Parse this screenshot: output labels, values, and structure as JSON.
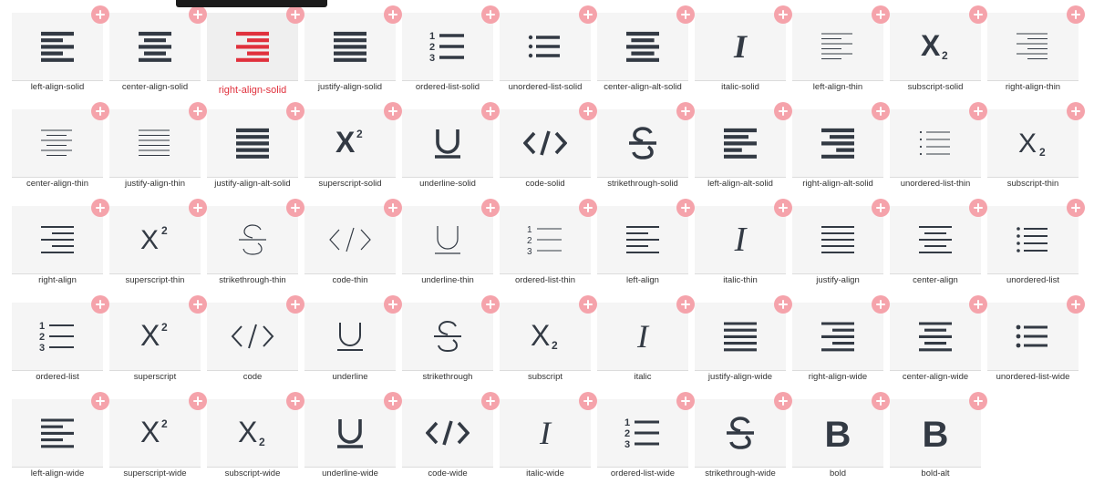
{
  "colors": {
    "icon": "#333a44",
    "active_icon": "#e0313d",
    "plus": "#f5a3ab",
    "tile": "#f5f5f5"
  },
  "active_index": 2,
  "tooltip": {
    "text": ""
  },
  "icons": [
    {
      "label": "left-align-solid"
    },
    {
      "label": "center-align-solid"
    },
    {
      "label": "right-align-solid"
    },
    {
      "label": "justify-align-solid"
    },
    {
      "label": "ordered-list-solid"
    },
    {
      "label": "unordered-list-solid"
    },
    {
      "label": "center-align-alt-solid"
    },
    {
      "label": "italic-solid"
    },
    {
      "label": "left-align-thin"
    },
    {
      "label": "subscript-solid"
    },
    {
      "label": "right-align-thin"
    },
    {
      "label": "center-align-thin"
    },
    {
      "label": "justify-align-thin"
    },
    {
      "label": "justify-align-alt-solid"
    },
    {
      "label": "superscript-solid"
    },
    {
      "label": "underline-solid"
    },
    {
      "label": "code-solid"
    },
    {
      "label": "strikethrough-solid"
    },
    {
      "label": "left-align-alt-solid"
    },
    {
      "label": "right-align-alt-solid"
    },
    {
      "label": "unordered-list-thin"
    },
    {
      "label": "subscript-thin"
    },
    {
      "label": "right-align"
    },
    {
      "label": "superscript-thin"
    },
    {
      "label": "strikethrough-thin"
    },
    {
      "label": "code-thin"
    },
    {
      "label": "underline-thin"
    },
    {
      "label": "ordered-list-thin"
    },
    {
      "label": "left-align"
    },
    {
      "label": "italic-thin"
    },
    {
      "label": "justify-align"
    },
    {
      "label": "center-align"
    },
    {
      "label": "unordered-list"
    },
    {
      "label": "ordered-list"
    },
    {
      "label": "superscript"
    },
    {
      "label": "code"
    },
    {
      "label": "underline"
    },
    {
      "label": "strikethrough"
    },
    {
      "label": "subscript"
    },
    {
      "label": "italic"
    },
    {
      "label": "justify-align-wide"
    },
    {
      "label": "right-align-wide"
    },
    {
      "label": "center-align-wide"
    },
    {
      "label": "unordered-list-wide"
    },
    {
      "label": "left-align-wide"
    },
    {
      "label": "superscript-wide"
    },
    {
      "label": "subscript-wide"
    },
    {
      "label": "underline-wide"
    },
    {
      "label": "code-wide"
    },
    {
      "label": "italic-wide"
    },
    {
      "label": "ordered-list-wide"
    },
    {
      "label": "strikethrough-wide"
    },
    {
      "label": "bold"
    },
    {
      "label": "bold-alt"
    }
  ]
}
